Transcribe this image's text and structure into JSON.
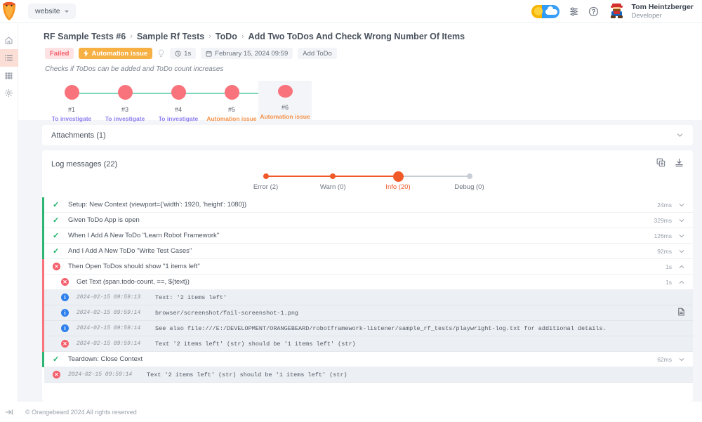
{
  "topbar": {
    "project_switcher": "website",
    "theme_toggle_name": "theme-toggle",
    "user": {
      "name": "Tom Heintzberger",
      "role": "Developer"
    }
  },
  "sidebar": {
    "items": [
      {
        "icon": "home-icon",
        "active": false
      },
      {
        "icon": "list-icon",
        "active": true
      },
      {
        "icon": "grid-icon",
        "active": false
      },
      {
        "icon": "gear-icon",
        "active": false
      }
    ],
    "collapse_icon": "expand-sidebar-icon"
  },
  "breadcrumb": [
    "RF Sample Tests #6",
    "Sample Rf Tests",
    "ToDo",
    "Add Two ToDos And Check Wrong Number Of Items"
  ],
  "meta": {
    "status": "Failed",
    "defect": "Automation issue",
    "duration": "1s",
    "date": "February 15, 2024 09:59",
    "tag": "Add ToDo",
    "description": "Checks if ToDos can be added and ToDo count increases"
  },
  "timeline": [
    {
      "num": "#1",
      "status": "To investigate",
      "kind": "investigate",
      "selected": false
    },
    {
      "num": "#3",
      "status": "To investigate",
      "kind": "investigate",
      "selected": false
    },
    {
      "num": "#4",
      "status": "To investigate",
      "kind": "investigate",
      "selected": false
    },
    {
      "num": "#5",
      "status": "Automation issue",
      "kind": "automation",
      "selected": false
    },
    {
      "num": "#6",
      "status": "Automation issue",
      "kind": "automation",
      "selected": true
    }
  ],
  "attachments": {
    "title": "Attachments (1)",
    "chevron": "chevron-down-icon"
  },
  "logs": {
    "title": "Log messages (22)",
    "copy_icon": "copy-icon",
    "download_icon": "download-icon",
    "levels": [
      {
        "label": "Error (2)",
        "active": false,
        "pos": 0
      },
      {
        "label": "Warn (0)",
        "active": false,
        "pos": 33
      },
      {
        "label": "Info (20)",
        "active": true,
        "pos": 66
      },
      {
        "label": "Debug (0)",
        "active": false,
        "pos": 100
      }
    ],
    "rows": [
      {
        "id": "r1",
        "type": "step",
        "icon": "check-icon",
        "text": "Setup: New Context (viewport={'width': 1920, 'height': 1080})",
        "duration": "24ms",
        "chevron": "chevron-down-icon",
        "bar": "pass"
      },
      {
        "id": "r2",
        "type": "step",
        "icon": "check-icon",
        "text": "Given ToDo App is open",
        "duration": "329ms",
        "chevron": "chevron-down-icon",
        "bar": "pass"
      },
      {
        "id": "r3",
        "type": "step",
        "icon": "check-icon",
        "text": "When I Add A New ToDo \"Learn Robot Framework\"",
        "duration": "126ms",
        "chevron": "chevron-down-icon",
        "bar": "pass"
      },
      {
        "id": "r4",
        "type": "step",
        "icon": "check-icon",
        "text": "And I Add A New ToDo \"Write Test Cases\"",
        "duration": "92ms",
        "chevron": "chevron-down-icon",
        "bar": "pass"
      },
      {
        "id": "r5",
        "type": "step-failed",
        "icon": "error-icon",
        "text": "Then Open ToDos should show \"1 items left\"",
        "duration": "1s",
        "chevron": "chevron-up-icon",
        "bar": "fail"
      },
      {
        "id": "r6",
        "type": "substep-failed",
        "icon": "error-icon",
        "text": "Get Text (span.todo-count, ==, ${text})",
        "duration": "1s",
        "chevron": "chevron-up-icon",
        "bar": "fail"
      },
      {
        "id": "r7",
        "type": "message-info",
        "icon": "info-icon",
        "timestamp": "2024-02-15 09:59:13",
        "text": "Text: '2 items left'",
        "bar": "fail"
      },
      {
        "id": "r8",
        "type": "message-info",
        "icon": "info-icon",
        "timestamp": "2024-02-15 09:59:14",
        "text": "browser/screenshot/fail-screenshot-1.png",
        "attachment_icon": "file-icon",
        "bar": "fail"
      },
      {
        "id": "r9",
        "type": "message-info",
        "icon": "info-icon",
        "timestamp": "2024-02-15 09:59:14",
        "text": "See also file:///E:/DEVELOPMENT/ORANGEBEARD/robotframework-listener/sample_rf_tests/playwright-log.txt for additional details.",
        "bar": "fail"
      },
      {
        "id": "r10",
        "type": "message-error",
        "icon": "error-icon",
        "timestamp": "2024-02-15 09:59:14",
        "text": "Text '2 items left' (str) should be '1 items left' (str)",
        "bar": "fail"
      },
      {
        "id": "r11",
        "type": "step",
        "icon": "check-icon",
        "text": "Teardown: Close Context",
        "duration": "62ms",
        "chevron": "chevron-down-icon",
        "bar": "pass"
      },
      {
        "id": "r12",
        "type": "message-error-root",
        "icon": "error-icon",
        "timestamp": "2024-02-15 09:59:14",
        "text": "Text '2 items left' (str) should be '1 items left' (str)",
        "bar": "none"
      }
    ]
  },
  "footer": {
    "copyright": "© Orangebeard 2024 All rights reserved"
  },
  "colors": {
    "accent_orange": "#f05a28",
    "fail_red": "#f4606c",
    "pass_green": "#19b26b",
    "dot_red": "#f9737c",
    "timeline_line": "#7fd6bc",
    "investigate_purple": "#8a7ef0",
    "automation_orange": "#f5924a",
    "info_blue": "#2f80ed",
    "panel_bg": "#f3f5f8"
  }
}
